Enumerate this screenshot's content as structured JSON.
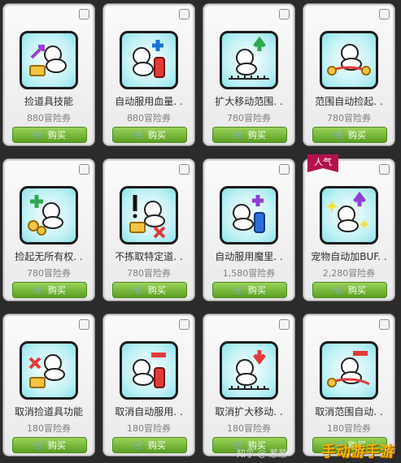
{
  "items": [
    {
      "name": "捡道具技能",
      "price": "880冒险券",
      "buy": "购买",
      "icon": "pet-pickup-item-icon",
      "badge": ""
    },
    {
      "name": "自动服用血量. .",
      "price": "880冒险券",
      "buy": "购买",
      "icon": "pet-auto-hp-icon",
      "badge": ""
    },
    {
      "name": "扩大移动范围. .",
      "price": "780冒险券",
      "buy": "购买",
      "icon": "pet-range-expand-icon",
      "badge": ""
    },
    {
      "name": "范围自动捡起. .",
      "price": "780冒险券",
      "buy": "购买",
      "icon": "pet-auto-pickup-range-icon",
      "badge": ""
    },
    {
      "name": "捡起无所有权. .",
      "price": "780冒险券",
      "buy": "购买",
      "icon": "pet-pickup-unowned-icon",
      "badge": ""
    },
    {
      "name": "不拣取特定道. .",
      "price": "780冒险券",
      "buy": "购买",
      "icon": "pet-ignore-item-icon",
      "badge": ""
    },
    {
      "name": "自动服用魔里. .",
      "price": "1,580冒险券",
      "buy": "购买",
      "icon": "pet-auto-mp-icon",
      "badge": ""
    },
    {
      "name": "宠物自动加BUF. .",
      "price": "2,280冒险券",
      "buy": "购买",
      "icon": "pet-auto-buff-icon",
      "badge": "人气"
    },
    {
      "name": "取消捡道具功能",
      "price": "180冒险券",
      "buy": "购买",
      "icon": "pet-cancel-pickup-icon",
      "badge": ""
    },
    {
      "name": "取消自动服用. .",
      "price": "180冒险券",
      "buy": "购买",
      "icon": "pet-cancel-auto-use-icon",
      "badge": ""
    },
    {
      "name": "取消扩大移动. .",
      "price": "180冒险券",
      "buy": "购买",
      "icon": "pet-cancel-range-icon",
      "badge": ""
    },
    {
      "name": "取消范围自动. .",
      "price": "180冒险券",
      "buy": "购买",
      "icon": "pet-cancel-auto-pickup-icon",
      "badge": ""
    }
  ],
  "watermark": {
    "text": "手动游手游",
    "source": "知乎 @ 葱葱"
  },
  "colors": {
    "buy_button": "#6cb22e",
    "badge": "#b1124f",
    "icon_bg": "#bff1f4"
  }
}
